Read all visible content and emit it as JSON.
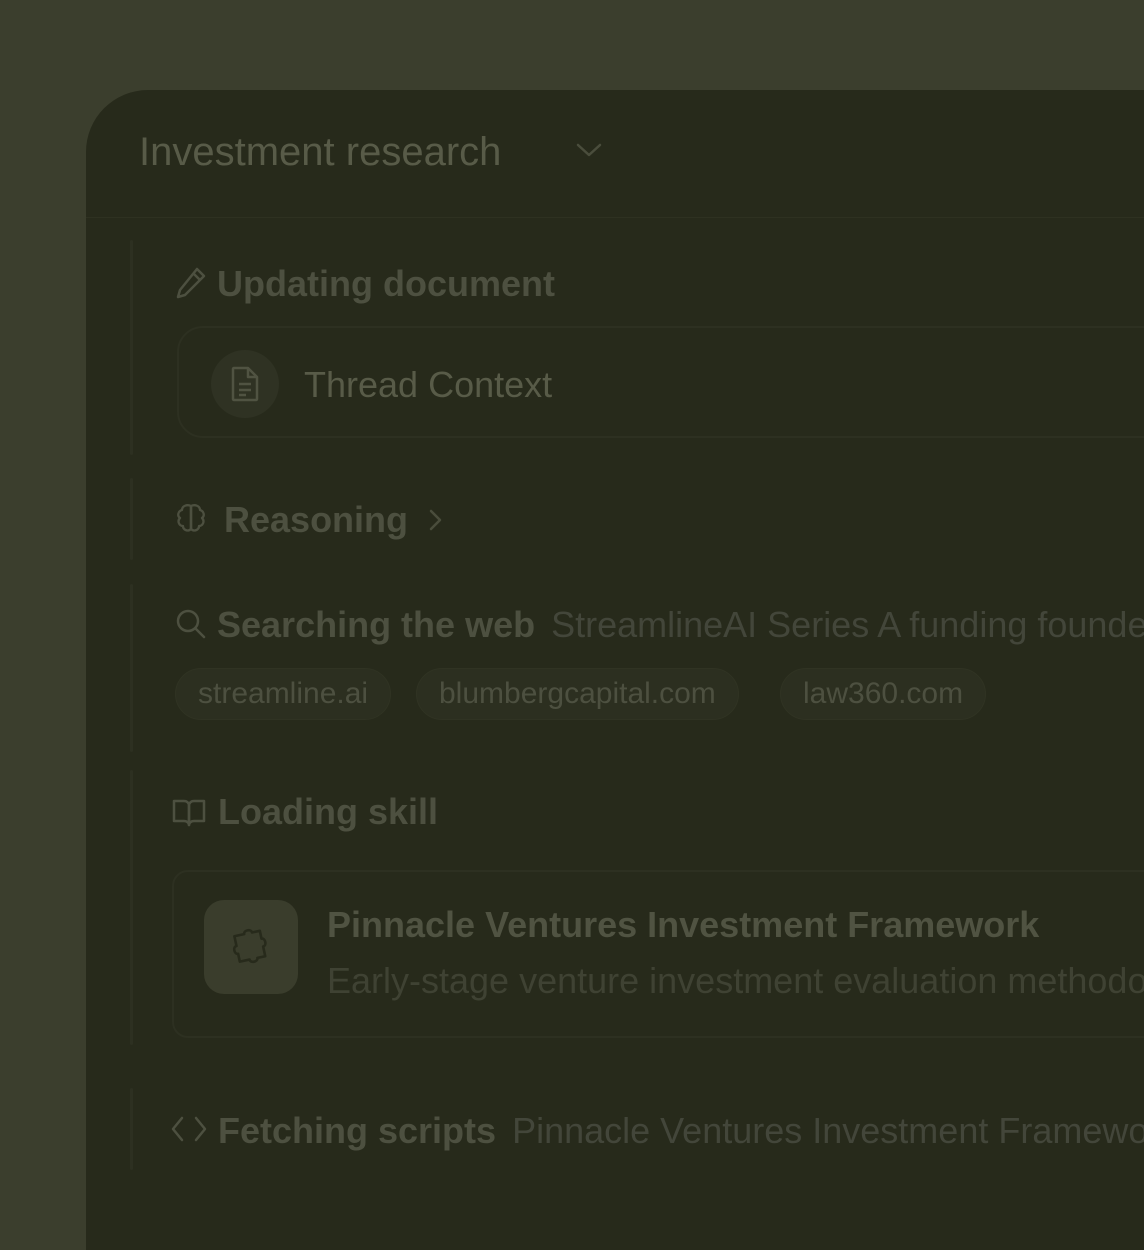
{
  "header": {
    "title": "Investment research",
    "chevron_icon": "chevron-down-icon"
  },
  "steps": {
    "updating": {
      "icon": "pencil-icon",
      "label": "Updating document",
      "document": {
        "icon": "file-text-icon",
        "name": "Thread Context"
      }
    },
    "reasoning": {
      "icon": "brain-icon",
      "label": "Reasoning",
      "chevron_icon": "chevron-right-icon"
    },
    "search": {
      "icon": "search-icon",
      "label": "Searching the web",
      "query": "StreamlineAI Series A funding founders",
      "sources": [
        "streamline.ai",
        "blumbergcapital.com",
        "law360.com"
      ]
    },
    "skill": {
      "icon": "book-open-icon",
      "label": "Loading skill",
      "card": {
        "icon": "puzzle-icon",
        "title": "Pinnacle Ventures Investment Framework",
        "description": "Early-stage venture investment evaluation methodology"
      }
    },
    "scripts": {
      "icon": "code-icon",
      "label": "Fetching scripts",
      "detail": "Pinnacle Ventures Investment Framework"
    }
  }
}
